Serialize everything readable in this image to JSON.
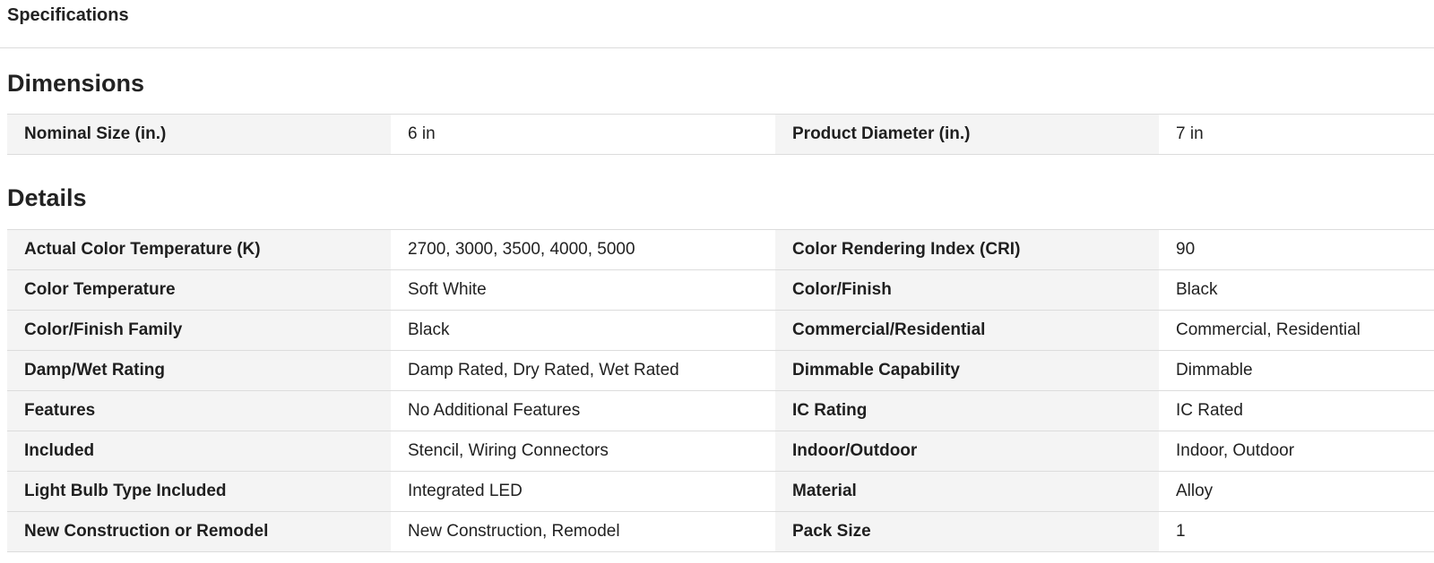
{
  "page": {
    "title": "Specifications"
  },
  "sections": [
    {
      "title": "Dimensions",
      "rows": [
        {
          "label1": "Nominal Size (in.)",
          "value1": "6 in",
          "label2": "Product Diameter (in.)",
          "value2": "7 in"
        }
      ]
    },
    {
      "title": "Details",
      "rows": [
        {
          "label1": "Actual Color Temperature (K)",
          "value1": "2700, 3000, 3500, 4000, 5000",
          "label2": "Color Rendering Index (CRI)",
          "value2": "90"
        },
        {
          "label1": "Color Temperature",
          "value1": "Soft White",
          "label2": "Color/Finish",
          "value2": "Black"
        },
        {
          "label1": "Color/Finish Family",
          "value1": "Black",
          "label2": "Commercial/Residential",
          "value2": "Commercial, Residential"
        },
        {
          "label1": "Damp/Wet Rating",
          "value1": "Damp Rated, Dry Rated, Wet Rated",
          "label2": "Dimmable Capability",
          "value2": "Dimmable"
        },
        {
          "label1": "Features",
          "value1": "No Additional Features",
          "label2": "IC Rating",
          "value2": "IC Rated"
        },
        {
          "label1": "Included",
          "value1": "Stencil, Wiring Connectors",
          "label2": "Indoor/Outdoor",
          "value2": "Indoor, Outdoor"
        },
        {
          "label1": "Light Bulb Type Included",
          "value1": "Integrated LED",
          "label2": "Material",
          "value2": "Alloy"
        },
        {
          "label1": "New Construction or Remodel",
          "value1": "New Construction, Remodel",
          "label2": "Pack Size",
          "value2": "1"
        }
      ]
    }
  ]
}
